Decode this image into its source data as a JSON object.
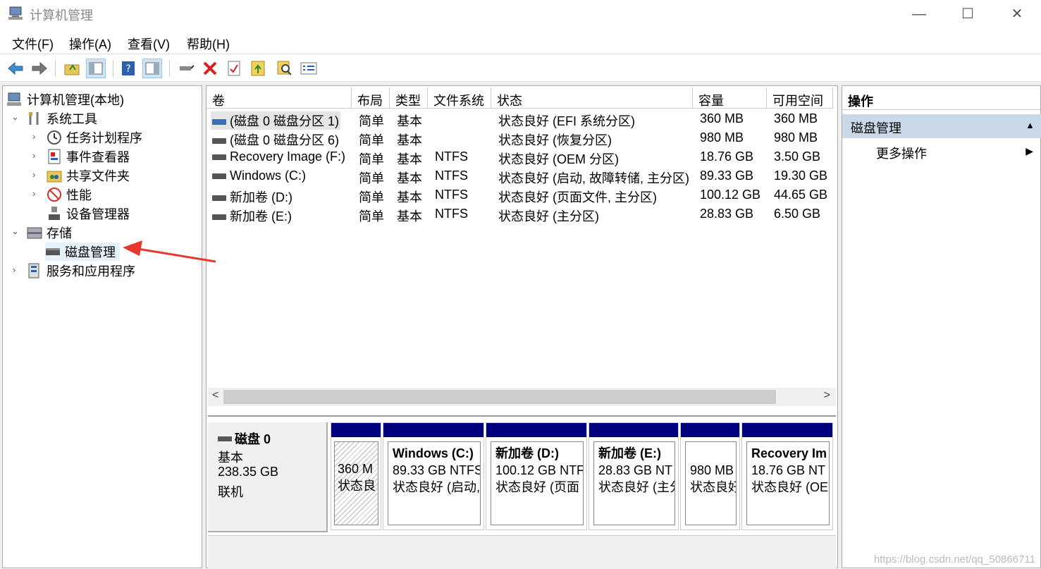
{
  "window": {
    "title": "计算机管理",
    "minimize": "—",
    "maximize": "☐",
    "close": "✕"
  },
  "menu": [
    "文件(F)",
    "操作(A)",
    "查看(V)",
    "帮助(H)"
  ],
  "toolbar": {
    "icons": [
      "back-arrow-icon",
      "forward-arrow-icon",
      "up-folder-icon",
      "show-hide-tree-icon",
      "help-icon",
      "show-hide-action-pane-icon",
      "connect-icon",
      "delete-icon",
      "properties-icon",
      "refresh-icon",
      "search-icon",
      "list-icon"
    ]
  },
  "tree": {
    "root": "计算机管理(本地)",
    "system_tools": "系统工具",
    "task_scheduler": "任务计划程序",
    "event_viewer": "事件查看器",
    "shared_folders": "共享文件夹",
    "performance": "性能",
    "device_manager": "设备管理器",
    "storage": "存储",
    "disk_management": "磁盘管理",
    "services_apps": "服务和应用程序"
  },
  "volumes": {
    "headers": [
      "卷",
      "布局",
      "类型",
      "文件系统",
      "状态",
      "容量",
      "可用空间"
    ],
    "rows": [
      {
        "name": "(磁盘 0 磁盘分区 1)",
        "layout": "简单",
        "type": "基本",
        "fs": "",
        "status": "状态良好 (EFI 系统分区)",
        "capacity": "360 MB",
        "free": "360 MB"
      },
      {
        "name": "(磁盘 0 磁盘分区 6)",
        "layout": "简单",
        "type": "基本",
        "fs": "",
        "status": "状态良好 (恢复分区)",
        "capacity": "980 MB",
        "free": "980 MB"
      },
      {
        "name": "Recovery Image (F:)",
        "layout": "简单",
        "type": "基本",
        "fs": "NTFS",
        "status": "状态良好 (OEM 分区)",
        "capacity": "18.76 GB",
        "free": "3.50 GB"
      },
      {
        "name": "Windows (C:)",
        "layout": "简单",
        "type": "基本",
        "fs": "NTFS",
        "status": "状态良好 (启动, 故障转储, 主分区)",
        "capacity": "89.33 GB",
        "free": "19.30 GB"
      },
      {
        "name": "新加卷 (D:)",
        "layout": "简单",
        "type": "基本",
        "fs": "NTFS",
        "status": "状态良好 (页面文件, 主分区)",
        "capacity": "100.12 GB",
        "free": "44.65 GB"
      },
      {
        "name": "新加卷 (E:)",
        "layout": "简单",
        "type": "基本",
        "fs": "NTFS",
        "status": "状态良好 (主分区)",
        "capacity": "28.83 GB",
        "free": "6.50 GB"
      }
    ]
  },
  "scroll": {
    "left": "<",
    "right": ">"
  },
  "disk": {
    "name": "磁盘 0",
    "type": "基本",
    "size": "238.35 GB",
    "status": "联机"
  },
  "partitions": [
    {
      "title": "",
      "line1": "360 M",
      "line2": "状态良"
    },
    {
      "title": "Windows  (C:)",
      "line1": "89.33 GB NTFS",
      "line2": "状态良好 (启动,"
    },
    {
      "title": "新加卷  (D:)",
      "line1": "100.12 GB NTF",
      "line2": "状态良好 (页面"
    },
    {
      "title": "新加卷  (E:)",
      "line1": "28.83 GB NT",
      "line2": "状态良好 (主分"
    },
    {
      "title": "",
      "line1": "980 MB",
      "line2": "状态良好"
    },
    {
      "title": "Recovery Im",
      "line1": "18.76 GB NT",
      "line2": "状态良好 (OE"
    }
  ],
  "actions": {
    "title": "操作",
    "section": "磁盘管理",
    "more": "更多操作",
    "collapse": "▲",
    "expand": "▶"
  },
  "watermark": "https://blog.csdn.net/qq_50866711",
  "colors": {
    "partition_header": "#00007f",
    "selected_section": "#c9d9ea",
    "annotation_arrow": "#e8382e"
  }
}
